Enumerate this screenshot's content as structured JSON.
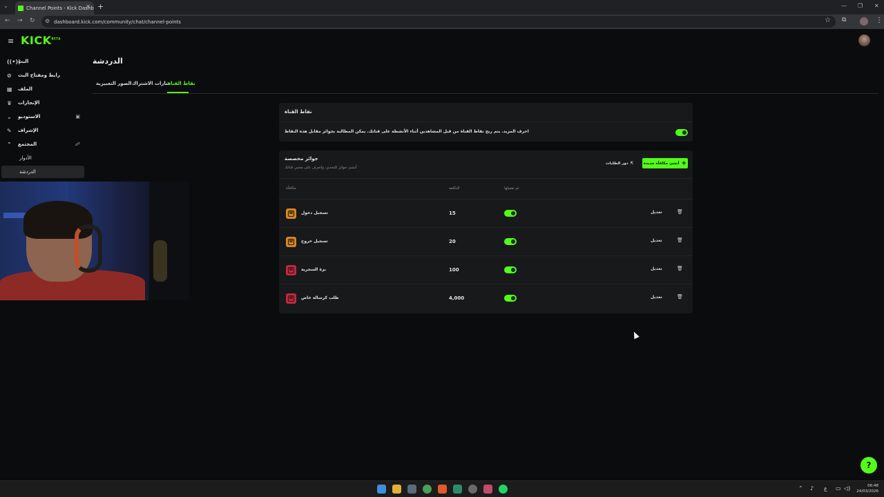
{
  "browser": {
    "tab_title": "Channel Points - Kick Dashboa",
    "url": "dashboard.kick.com/community/chat/channel-points"
  },
  "app": {
    "logo": "KICK",
    "logo_sup": "BETA"
  },
  "sidebar": {
    "items": [
      {
        "label": "البث",
        "icon": "broadcast-icon"
      },
      {
        "label": "رابط ومفتاح البث",
        "icon": "link-icon"
      },
      {
        "label": "الملف",
        "icon": "file-icon"
      },
      {
        "label": "الإنجازات",
        "icon": "trophy-icon"
      },
      {
        "label": "الاستوديو",
        "icon": "chevron-down-icon"
      },
      {
        "label": "الإشراف",
        "icon": "wrench-icon"
      },
      {
        "label": "المجتمع",
        "icon": "chevron-up-icon"
      },
      {
        "label": "الأدوار",
        "icon": ""
      },
      {
        "label": "الدردشة",
        "icon": ""
      }
    ]
  },
  "page": {
    "title": "الدردشة",
    "tabs": [
      "الصور التعبيرية",
      "شارات الاشتراك",
      "نقاط القناة"
    ]
  },
  "channel_points": {
    "title": "نقاط القناة",
    "description": "احرف المزيد. يتم ربح نقاط القناة من قبل المشاهدين أثناء الأنشطة على قناتك. يمكن المطالبة بجوائز مقابل هذه النقاط",
    "enabled": true
  },
  "custom_rewards": {
    "title": "جوائز مخصصة",
    "subtitle": "أنشئ جوائز للتحدي، واتعرف على محبي قناتك",
    "requests_label": "دور الطلبات",
    "new_button_label": "أنشئ مكافأة جديدة",
    "columns": {
      "reward": "مكافأة",
      "cost": "التكلفة",
      "enabled": "تم تفعيلها"
    },
    "edit_label": "تعديل",
    "rows": [
      {
        "name": "تسجيل دخول",
        "cost": "15",
        "enabled": true,
        "color": "#d9861f"
      },
      {
        "name": "تسجيل خروج",
        "cost": "20",
        "enabled": true,
        "color": "#d9861f"
      },
      {
        "name": "بزة السجرية",
        "cost": "100",
        "enabled": true,
        "color": "#c7263e"
      },
      {
        "name": "طلب كرسالة خاص",
        "cost": "4,000",
        "enabled": true,
        "color": "#c7263e"
      }
    ]
  },
  "taskbar": {
    "time": "06:48",
    "date": "24/03/2026",
    "lang": "ع"
  },
  "colors": {
    "accent": "#53fc18",
    "bg": "#0b0c0d",
    "card": "#18191b"
  }
}
